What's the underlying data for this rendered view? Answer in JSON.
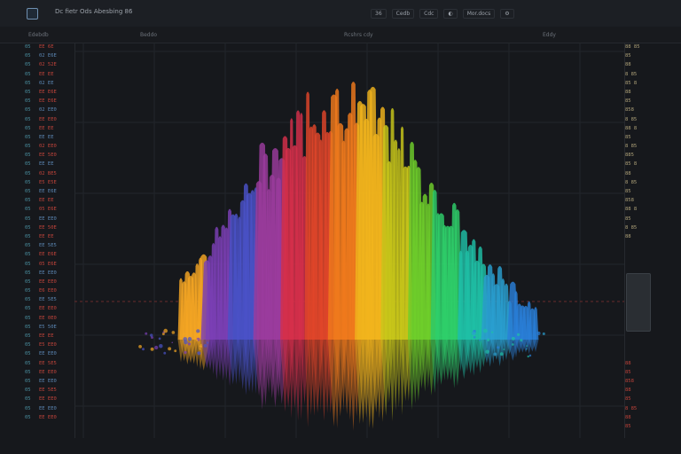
{
  "window": {
    "title": "Dc fietr Ods Abesbing  86"
  },
  "toolbar": {
    "items": [
      "36",
      "Cedb",
      "Cdc",
      "",
      "Mor.docs",
      ""
    ]
  },
  "ruler": {
    "left_label": "Edebdb",
    "mid_label": "Beddo",
    "center_label": "Rcshrs cdy",
    "right_label": "Eddy"
  },
  "left_panel": {
    "rows": [
      {
        "idx": "05",
        "val": "EE 6E"
      },
      {
        "idx": "05",
        "val": "02 E6E"
      },
      {
        "idx": "05",
        "val": "02 52E"
      },
      {
        "idx": "05",
        "val": "EE EE"
      },
      {
        "idx": "05",
        "val": "02 EE"
      },
      {
        "idx": "05",
        "val": "EE E6E"
      },
      {
        "idx": "05",
        "val": "EE E6E"
      },
      {
        "idx": "05",
        "val": "02 EE0"
      },
      {
        "idx": "05",
        "val": "EE EE0"
      },
      {
        "idx": "05",
        "val": "EE EE"
      },
      {
        "idx": "05",
        "val": "EE EE"
      },
      {
        "idx": "05",
        "val": "02 EE0"
      },
      {
        "idx": "05",
        "val": "EE 5E0"
      },
      {
        "idx": "05",
        "val": "EE EE"
      },
      {
        "idx": "05",
        "val": "02 BE5"
      },
      {
        "idx": "05",
        "val": "E5 E5E"
      },
      {
        "idx": "05",
        "val": "EE E6E"
      },
      {
        "idx": "05",
        "val": "EE EE"
      },
      {
        "idx": "05",
        "val": "05 E6E"
      },
      {
        "idx": "05",
        "val": "EE EE0"
      },
      {
        "idx": "05",
        "val": "EE 50E"
      },
      {
        "idx": "05",
        "val": "EE EE"
      },
      {
        "idx": "05",
        "val": "EE 5E5"
      },
      {
        "idx": "05",
        "val": "EE E6E"
      },
      {
        "idx": "05",
        "val": "05 E6E"
      },
      {
        "idx": "05",
        "val": "EE EE0"
      },
      {
        "idx": "05",
        "val": "EE EE0"
      },
      {
        "idx": "05",
        "val": "E6 EE0"
      },
      {
        "idx": "05",
        "val": "EE 5E5"
      },
      {
        "idx": "05",
        "val": "EE EE0"
      },
      {
        "idx": "05",
        "val": "EE 0E0"
      },
      {
        "idx": "05",
        "val": "E5 50E"
      },
      {
        "idx": "05",
        "val": "EE EE"
      },
      {
        "idx": "05",
        "val": "E5 EE0"
      },
      {
        "idx": "05",
        "val": "EE EE0"
      },
      {
        "idx": "05",
        "val": "EE 5E5"
      },
      {
        "idx": "05",
        "val": "EE EE0"
      },
      {
        "idx": "05",
        "val": "EE EE0"
      },
      {
        "idx": "05",
        "val": "EE 5E5"
      },
      {
        "idx": "05",
        "val": "EE EE0"
      },
      {
        "idx": "05",
        "val": "EE EE0"
      },
      {
        "idx": "05",
        "val": "EE EE0"
      }
    ]
  },
  "right_panel": {
    "rows": [
      "88 85",
      "85",
      "88",
      "8 85",
      "85 8",
      "88",
      "85",
      "858",
      "8 85",
      "88 8",
      "85",
      "8 85",
      "885",
      "85 8",
      "88",
      "8 85",
      "85",
      "858",
      "88 8",
      "85",
      "8 85",
      "88",
      "",
      "",
      "",
      "",
      "",
      "",
      "",
      "",
      "",
      "",
      "",
      "",
      "",
      "88",
      "85",
      "858",
      "88",
      "85",
      "8 85",
      "88",
      "85"
    ]
  },
  "colors": {
    "background": "#16181c",
    "spectrum": [
      "#f5a623",
      "#7b3fb6",
      "#4a52c8",
      "#9b3c9e",
      "#d62f4b",
      "#e0452a",
      "#f07a1c",
      "#f2b41c",
      "#c9c81a",
      "#6fcf2b",
      "#2ecf6a",
      "#1fbfa6",
      "#2a9fd0",
      "#2a7fd8"
    ]
  }
}
